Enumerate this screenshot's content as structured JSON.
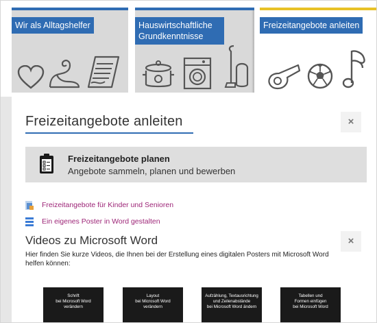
{
  "tabs": [
    {
      "label": "Wir als Alltagshelfer",
      "icons": [
        "heart-icon",
        "muscle-arm-icon",
        "document-icon"
      ]
    },
    {
      "label": "Hauswirtschaftliche Grundkenntnisse",
      "icons": [
        "cooking-pot-icon",
        "washing-machine-icon",
        "vacuum-cleaner-icon"
      ]
    },
    {
      "label": "Freizeitangebote anleiten",
      "icons": [
        "whistle-icon",
        "soccer-ball-icon",
        "music-note-icon"
      ]
    }
  ],
  "colors": {
    "accent": "#2f6cb3",
    "active_tab": "#e8c227",
    "link": "#9d2577"
  },
  "panel": {
    "title": "Freizeitangebote anleiten",
    "close_label": "×",
    "plan": {
      "title": "Freizeitangebote planen",
      "subtitle": "Angebote sammeln, planen und bewerben",
      "icon": "clipboard-icon"
    },
    "links": [
      {
        "label": "Freizeitangebote für Kinder und Senioren",
        "icon": "document-link-icon"
      },
      {
        "label": "Ein eigenes Poster in Word gestalten",
        "icon": "list-link-icon"
      }
    ],
    "videos": {
      "title": "Videos zu Microsoft Word",
      "close_label": "×",
      "description": "Hier finden Sie kurze Videos, die Ihnen bei der Erstellung eines digitalen Posters mit Microsoft Word helfen können:",
      "items": [
        {
          "text": "Schrift\nbei Microsoft Word\nverändern"
        },
        {
          "text": "Layout\nbei Microsoft Word\nverändern"
        },
        {
          "text": "Aufzählung, Textausrichtung\nund Zeilenabstände\nbei Microsoft Word ändern"
        },
        {
          "text": "Tabellen und\nFormen einfügen\nbei Microsoft Word"
        }
      ]
    }
  }
}
